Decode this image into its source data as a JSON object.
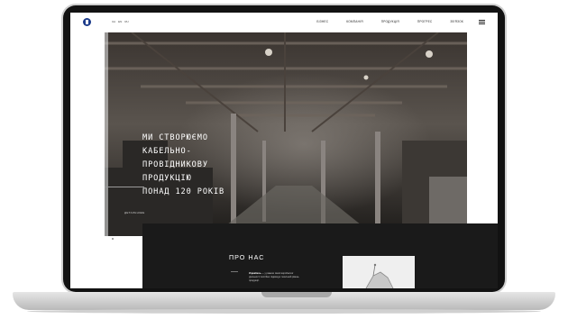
{
  "header": {
    "lang": [
      "UA",
      "EN",
      "RU"
    ],
    "nav": [
      "Бізнес",
      "Компанія",
      "Продукція",
      "Прогрес",
      "Зв'язок"
    ]
  },
  "hero": {
    "title_lines": [
      "МИ СТВОРЮЄМО КАБЕЛЬНО-",
      "ПРОВІДНИКОВУ ПРОДУКЦІЮ",
      "ПОНАД 120 РОКІВ"
    ],
    "more": "ДЕТАЛЬНІШЕ"
  },
  "about": {
    "title": "ПРО НАС",
    "lead": "Укркабель",
    "text": "— у рамках своєї виробничої діяльності постійно підвищує технічний рівень продукції."
  },
  "colors": {
    "accent": "#1c3b8a",
    "dark": "#1a1a1a"
  }
}
